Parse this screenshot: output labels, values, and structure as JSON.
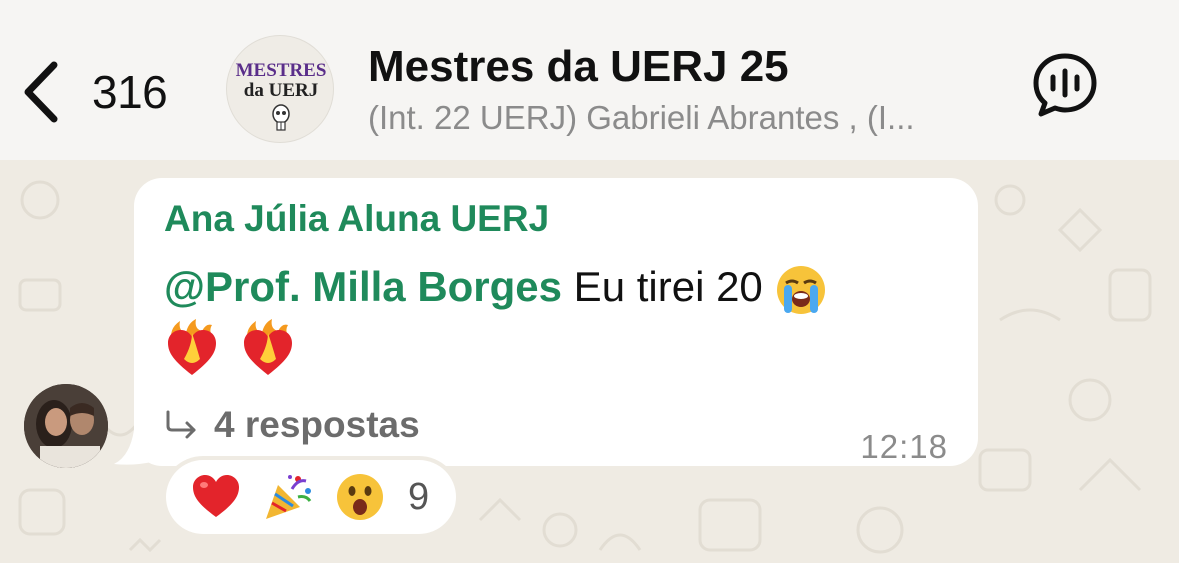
{
  "header": {
    "back_count": "316",
    "group_logo_text": "Mestres da UERJ",
    "title": "Mestres da UERJ 25",
    "subtitle": "(Int. 22 UERJ) Gabrieli Abrantes , (I...",
    "voice_icon": "voice-chat-icon"
  },
  "message": {
    "sender": "Ana Júlia Aluna UERJ",
    "mention": "@Prof. Milla Borges",
    "text": " Eu tirei 20",
    "emojis": [
      "loudly-crying-face",
      "heart-on-fire",
      "heart-on-fire"
    ],
    "replies_label": "4 respostas",
    "time": "12:18"
  },
  "reactions": {
    "emojis": [
      "red-heart",
      "party-popper",
      "astonished-face"
    ],
    "count": "9"
  },
  "colors": {
    "accent_green": "#1f8a5b",
    "header_bg": "#f6f5f3",
    "chat_bg": "#efebe3"
  }
}
